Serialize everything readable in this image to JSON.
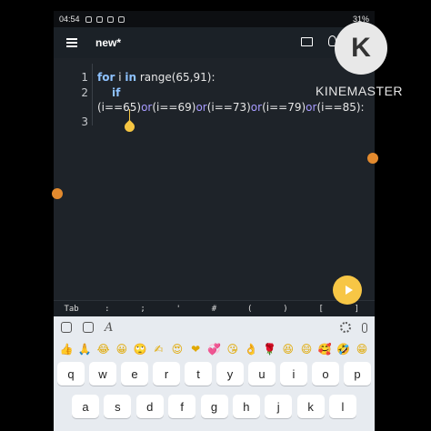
{
  "status": {
    "time": "04:54",
    "battery": "31%"
  },
  "appbar": {
    "title": "new*"
  },
  "editor": {
    "line_numbers": [
      "1",
      "2",
      "3"
    ],
    "line1": {
      "kw_for": "for",
      "text1": " i ",
      "kw_in": "in",
      "text2": " range(65,91):"
    },
    "line2": {
      "kw_if": "if"
    },
    "line2b": {
      "p1": "(i==65)",
      "o1": "or",
      "p2": "(i==69)",
      "o2": "or",
      "p3": "(i==73)",
      "o3": "or",
      "p4": "(i==79)",
      "o4": "or",
      "p5": "(i==85):"
    }
  },
  "symbol_bar": [
    "Tab",
    ":",
    ";",
    "'",
    "#",
    "(",
    ")",
    "[",
    "]"
  ],
  "emoji_row": [
    "👍",
    "🙏",
    "😂",
    "😀",
    "🙄",
    "✍",
    "😍",
    "❤",
    "💞",
    "😘",
    "👌",
    "🌹",
    "😆",
    "😄",
    "🥰",
    "🤣",
    "😁"
  ],
  "keyboard": {
    "row1": [
      "q",
      "w",
      "e",
      "r",
      "t",
      "y",
      "u",
      "i",
      "o",
      "p"
    ],
    "row2": [
      "a",
      "s",
      "d",
      "f",
      "g",
      "h",
      "j",
      "k",
      "l"
    ]
  },
  "overlay": {
    "logo_letter": "K",
    "brand": "KINEMASTER"
  }
}
